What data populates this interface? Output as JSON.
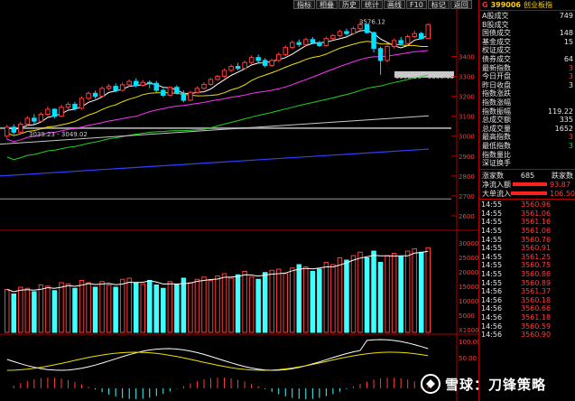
{
  "toolbar": [
    "指标",
    "相叠",
    "历史",
    "统计",
    "画线",
    "F10",
    "标记",
    "返回"
  ],
  "header": {
    "code": "399006",
    "name": "创业板指",
    "mark": "G"
  },
  "stats": [
    {
      "k": "A股成交",
      "v": "749",
      "c": "wht"
    },
    {
      "k": "B股成交",
      "v": "",
      "c": "wht"
    },
    {
      "k": "国债成交",
      "v": "148",
      "c": "wht"
    },
    {
      "k": "基金成交",
      "v": "15",
      "c": "wht"
    },
    {
      "k": "权证成交",
      "v": "",
      "c": "wht"
    },
    {
      "k": "债券成交",
      "v": "64",
      "c": "wht"
    },
    {
      "k": "最新指数",
      "v": "3",
      "c": "red"
    },
    {
      "k": "今日开盘",
      "v": "3",
      "c": "red"
    },
    {
      "k": "昨日收盘",
      "v": "3",
      "c": "wht"
    },
    {
      "k": "指数涨跌",
      "v": "",
      "c": "red"
    },
    {
      "k": "指数涨幅",
      "v": "",
      "c": "red"
    },
    {
      "k": "指数振幅",
      "v": "119.22",
      "c": "wht"
    },
    {
      "k": "总成交额",
      "v": "335",
      "c": "wht"
    },
    {
      "k": "总成交量",
      "v": "1652",
      "c": "wht"
    },
    {
      "k": "最高指数",
      "v": "3",
      "c": "red"
    },
    {
      "k": "最低指数",
      "v": "3",
      "c": "grn"
    },
    {
      "k": "指数量比",
      "v": "",
      "c": "wht"
    },
    {
      "k": "深证换手",
      "v": "",
      "c": "wht"
    }
  ],
  "updown": {
    "k": "涨家数",
    "v": "685",
    "k2": "跌家数"
  },
  "flows": [
    {
      "k": "净流入额",
      "v": "93.87",
      "w": 38
    },
    {
      "k": "大单流入",
      "v": "106.50",
      "w": 42
    }
  ],
  "ticks": [
    {
      "t": "14:55",
      "p": "3560.96"
    },
    {
      "t": "14:55",
      "p": "3561.06"
    },
    {
      "t": "14:55",
      "p": "3561.16"
    },
    {
      "t": "14:55",
      "p": "3561.06"
    },
    {
      "t": "14:55",
      "p": "3560.76"
    },
    {
      "t": "14:55",
      "p": "3560.91"
    },
    {
      "t": "14:55",
      "p": "3561.25"
    },
    {
      "t": "14:55",
      "p": "3560.75"
    },
    {
      "t": "14:55",
      "p": "3560.86"
    },
    {
      "t": "14:55",
      "p": "3560.89"
    },
    {
      "t": "14:56",
      "p": "3561.37"
    },
    {
      "t": "14:56",
      "p": "3560.18"
    },
    {
      "t": "14:56",
      "p": "3560.66"
    },
    {
      "t": "14:56",
      "p": "3561.18"
    },
    {
      "t": "14:56",
      "p": "3560.59"
    },
    {
      "t": "14:56",
      "p": "3560.90"
    }
  ],
  "annotations": {
    "high": "3576.12",
    "low": "3308.50 - 3338.13",
    "support": "3039.23 - 3049.02"
  },
  "price_axis": [
    "3400",
    "3300",
    "3200",
    "3100",
    "3000",
    "2900",
    "2800",
    "2700",
    "2600"
  ],
  "volume_axis": [
    "30000",
    "25000",
    "20000",
    "15000",
    "10000",
    "5000",
    "X10000"
  ],
  "macd_axis": [
    "100.00",
    "50.00"
  ],
  "watermark": "雪球：刀锋策略",
  "colors": {
    "up": "#ff3b3b",
    "down": "#00e0ff",
    "ma5": "#ffffff",
    "ma10": "#f0e000",
    "ma20": "#ff30ff",
    "ma60": "#20d020",
    "ma120": "#c8c8c8",
    "ma250": "#3040ff"
  },
  "chart_data": {
    "type": "candlestick",
    "candles": [
      [
        3000,
        3045,
        2985,
        3058
      ],
      [
        3045,
        3020,
        3008,
        3060
      ],
      [
        3020,
        3060,
        3010,
        3072
      ],
      [
        3060,
        3090,
        3050,
        3100
      ],
      [
        3090,
        3075,
        3060,
        3110
      ],
      [
        3075,
        3110,
        3068,
        3120
      ],
      [
        3110,
        3135,
        3100,
        3150
      ],
      [
        3135,
        3100,
        3090,
        3140
      ],
      [
        3100,
        3145,
        3095,
        3158
      ],
      [
        3145,
        3160,
        3130,
        3170
      ],
      [
        3160,
        3140,
        3128,
        3172
      ],
      [
        3140,
        3190,
        3135,
        3200
      ],
      [
        3190,
        3215,
        3180,
        3225
      ],
      [
        3215,
        3200,
        3188,
        3228
      ],
      [
        3200,
        3240,
        3195,
        3250
      ],
      [
        3240,
        3250,
        3230,
        3262
      ],
      [
        3250,
        3230,
        3220,
        3265
      ],
      [
        3230,
        3258,
        3225,
        3270
      ],
      [
        3258,
        3275,
        3248,
        3285
      ],
      [
        3275,
        3255,
        3245,
        3290
      ],
      [
        3255,
        3270,
        3248,
        3282
      ],
      [
        3270,
        3265,
        3240,
        3280
      ],
      [
        3265,
        3230,
        3220,
        3278
      ],
      [
        3230,
        3205,
        3198,
        3240
      ],
      [
        3205,
        3245,
        3200,
        3250
      ],
      [
        3245,
        3215,
        3208,
        3255
      ],
      [
        3215,
        3180,
        3170,
        3230
      ],
      [
        3180,
        3220,
        3175,
        3228
      ],
      [
        3220,
        3240,
        3214,
        3250
      ],
      [
        3240,
        3260,
        3232,
        3270
      ],
      [
        3260,
        3285,
        3254,
        3292
      ],
      [
        3285,
        3300,
        3278,
        3308
      ],
      [
        3300,
        3330,
        3292,
        3340
      ],
      [
        3330,
        3350,
        3322,
        3360
      ],
      [
        3350,
        3340,
        3330,
        3368
      ],
      [
        3340,
        3370,
        3335,
        3380
      ],
      [
        3370,
        3395,
        3360,
        3405
      ],
      [
        3395,
        3380,
        3370,
        3410
      ],
      [
        3380,
        3355,
        3345,
        3392
      ],
      [
        3355,
        3380,
        3348,
        3388
      ],
      [
        3380,
        3410,
        3372,
        3420
      ],
      [
        3410,
        3445,
        3402,
        3455
      ],
      [
        3445,
        3470,
        3436,
        3480
      ],
      [
        3470,
        3460,
        3448,
        3485
      ],
      [
        3460,
        3485,
        3452,
        3495
      ],
      [
        3485,
        3470,
        3462,
        3498
      ],
      [
        3470,
        3455,
        3448,
        3478
      ],
      [
        3455,
        3490,
        3450,
        3500
      ],
      [
        3490,
        3505,
        3482,
        3512
      ],
      [
        3505,
        3525,
        3496,
        3535
      ],
      [
        3525,
        3515,
        3505,
        3540
      ],
      [
        3515,
        3540,
        3508,
        3550
      ],
      [
        3540,
        3560,
        3530,
        3576
      ],
      [
        3560,
        3520,
        3515,
        3565
      ],
      [
        3520,
        3440,
        3420,
        3525
      ],
      [
        3440,
        3380,
        3308,
        3450
      ],
      [
        3380,
        3450,
        3370,
        3460
      ],
      [
        3450,
        3480,
        3440,
        3490
      ],
      [
        3480,
        3465,
        3455,
        3498
      ],
      [
        3465,
        3500,
        3460,
        3510
      ],
      [
        3500,
        3515,
        3492,
        3530
      ],
      [
        3515,
        3490,
        3485,
        3525
      ],
      [
        3490,
        3560,
        3488,
        3566
      ]
    ],
    "volume": [
      19000,
      17000,
      20000,
      19500,
      18000,
      21000,
      20500,
      18500,
      22000,
      21500,
      19500,
      23000,
      22000,
      20000,
      22500,
      21000,
      20000,
      23500,
      24000,
      22000,
      21500,
      23000,
      21000,
      19500,
      22500,
      21000,
      24000,
      22000,
      23500,
      24500,
      23000,
      25000,
      26000,
      24000,
      25500,
      27000,
      24500,
      23500,
      26500,
      27500,
      28000,
      26000,
      28500,
      30000,
      29000,
      27000,
      28000,
      31000,
      30000,
      33000,
      32000,
      34000,
      35500,
      33000,
      36000,
      31000,
      34000,
      35000,
      33500,
      36000,
      37000,
      35500,
      37500
    ],
    "x_range": [
      "",
      ""
    ],
    "ylim": [
      2550,
      3620
    ]
  }
}
